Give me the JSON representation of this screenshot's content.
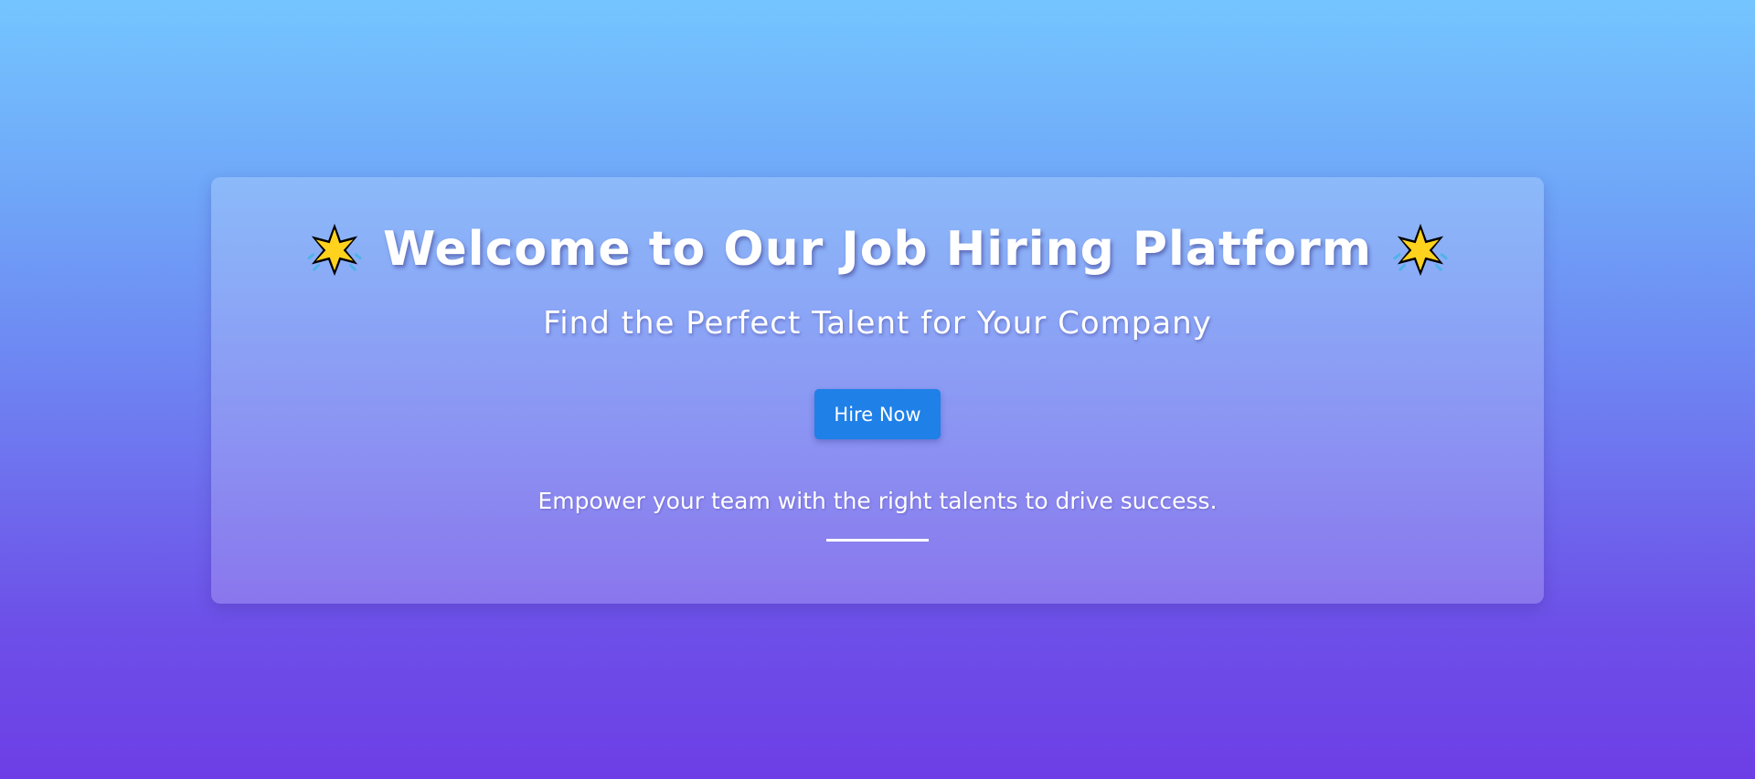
{
  "hero": {
    "title": "Welcome to Our Job Hiring Platform",
    "left_icon": "glowing-star-icon",
    "right_icon": "glowing-star-icon",
    "subtitle": "Find the Perfect Talent for Your Company",
    "cta_label": "Hire Now",
    "tagline": "Empower your team with the right talents to drive success."
  },
  "colors": {
    "background_top": "#74c5ff",
    "background_bottom": "#6d3ee6",
    "button": "#1f80e8",
    "star_fill": "#ffd21e",
    "text": "#ffffff"
  }
}
